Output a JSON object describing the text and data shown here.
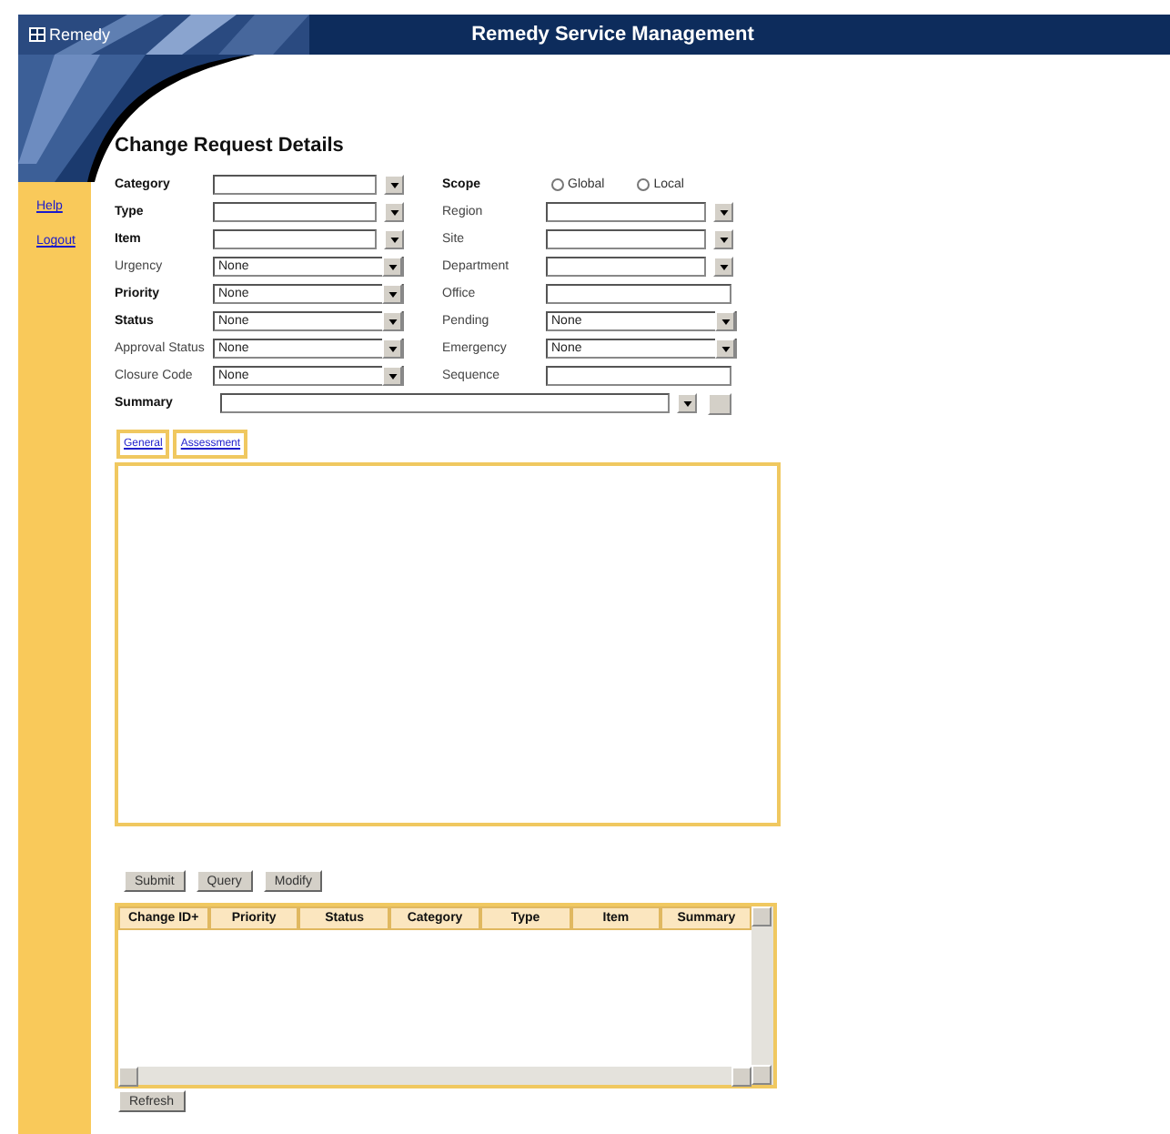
{
  "header": {
    "logo": "Remedy",
    "title": "Remedy Service Management"
  },
  "sidebar": {
    "links": [
      {
        "label": "Help"
      },
      {
        "label": "Logout"
      }
    ]
  },
  "form": {
    "title": "Change Request Details",
    "rows": [
      {
        "left": {
          "label": "Category",
          "required": true,
          "kind": "dropdown"
        },
        "right": {
          "label": "Scope",
          "required": true,
          "kind": "radio",
          "options": [
            {
              "label": "Global",
              "selected": false
            },
            {
              "label": "Local",
              "selected": false
            }
          ]
        }
      },
      {
        "left": {
          "label": "Type",
          "required": true,
          "kind": "dropdown"
        },
        "right": {
          "label": "Region",
          "required": false,
          "kind": "dropdown"
        }
      },
      {
        "left": {
          "label": "Item",
          "required": true,
          "kind": "dropdown"
        },
        "right": {
          "label": "Site",
          "required": false,
          "kind": "dropdown"
        }
      },
      {
        "left": {
          "label": "Urgency",
          "required": false,
          "kind": "select",
          "value": "None"
        },
        "right": {
          "label": "Department",
          "required": false,
          "kind": "dropdown"
        }
      },
      {
        "left": {
          "label": "Priority",
          "required": true,
          "kind": "select",
          "value": "None"
        },
        "right": {
          "label": "Office",
          "required": false,
          "kind": "text"
        }
      },
      {
        "left": {
          "label": "Status",
          "required": true,
          "kind": "select",
          "value": "None"
        },
        "right": {
          "label": "Pending",
          "required": false,
          "kind": "select",
          "value": "None"
        }
      },
      {
        "left": {
          "label": "Approval Status",
          "required": false,
          "kind": "select",
          "value": "None"
        },
        "right": {
          "label": "Emergency",
          "required": false,
          "kind": "select",
          "value": "None"
        }
      },
      {
        "left": {
          "label": "Closure Code",
          "required": false,
          "kind": "select",
          "value": "None"
        },
        "right": {
          "label": "Sequence",
          "required": false,
          "kind": "text"
        }
      }
    ],
    "summary": {
      "label": "Summary",
      "required": true
    }
  },
  "tabs": [
    {
      "label": "General",
      "selected": false
    },
    {
      "label": "Assessment",
      "selected": false
    }
  ],
  "buttons": [
    "Submit",
    "Query",
    "Modify"
  ],
  "table": {
    "columns": [
      "Change ID+",
      "Priority",
      "Status",
      "Category",
      "Type",
      "Item",
      "Summary"
    ]
  },
  "refresh_button": "Refresh"
}
